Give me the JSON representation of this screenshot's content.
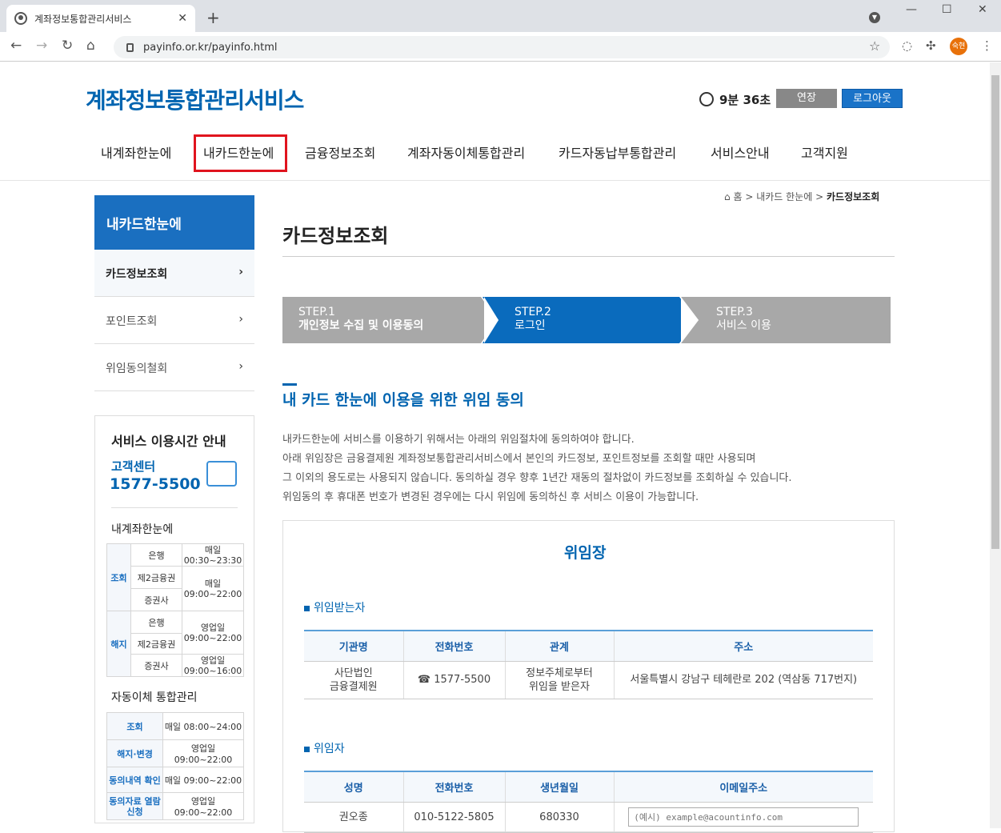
{
  "browser": {
    "tab_title": "계좌정보통합관리서비스",
    "tab_close": "✕",
    "new_tab": "+",
    "url": "payinfo.or.kr/payinfo.html",
    "profile_label": "숙현",
    "icons": [
      "back-icon",
      "forward-icon",
      "reload-icon",
      "home-icon",
      "lock-icon",
      "star-icon",
      "puzzle-icon",
      "menu-icon"
    ]
  },
  "header": {
    "logo": "계좌정보통합관리서비스",
    "timer": "9분 36초",
    "extend": "연장",
    "logout": "로그아웃"
  },
  "gnb": [
    "내계좌한눈에",
    "내카드한눈에",
    "금융정보조회",
    "계좌자동이체통합관리",
    "카드자동납부통합관리",
    "서비스안내",
    "고객지원"
  ],
  "lnb": {
    "title": "내카드한눈에",
    "items": [
      "카드정보조회",
      "포인트조회",
      "위임동의철회"
    ]
  },
  "service_hours": {
    "title": "서비스 이용시간 안내",
    "cc_label": "고객센터",
    "cc_number": "1577-5500",
    "sec1_title": "내계좌한눈에",
    "sec1": {
      "k1": "조회",
      "k2": "해지",
      "r1": "은행",
      "r2": "제2금융권",
      "r3": "증권사",
      "r4": "은행",
      "r5": "제2금융권",
      "r6": "증권사",
      "v1a": "매일",
      "v1b": "00:30~23:30",
      "v2a": "매일",
      "v2b": "09:00~22:00",
      "v3a": "영업일",
      "v3b": "09:00~22:00",
      "v4a": "영업일",
      "v4b": "09:00~16:00"
    },
    "sec2_title": "자동이체 통합관리",
    "sec2": [
      {
        "k": "조회",
        "v": "매일 08:00~24:00"
      },
      {
        "k": "해지·변경",
        "v": "영업일 09:00~22:00"
      },
      {
        "k": "동의내역 확인",
        "v": "매일 09:00~22:00"
      },
      {
        "k": "동의자료 열람신청",
        "v": "영업일 09:00~22:00"
      }
    ]
  },
  "breadcrumb": {
    "home": "홈",
    "mid": "내카드 한눈에",
    "current": "카드정보조회",
    "sep": ">"
  },
  "page_title": "카드정보조회",
  "steps": [
    {
      "num": "STEP.1",
      "label": "개인정보 수집 및 이용동의"
    },
    {
      "num": "STEP.2",
      "label": "로그인"
    },
    {
      "num": "STEP.3",
      "label": "서비스 이용"
    }
  ],
  "section_title": "내 카드 한눈에 이용을 위한 위임 동의",
  "description": [
    "내카드한눈에 서비스를 이용하기 위해서는 아래의 위임절차에 동의하여야 합니다.",
    "아래 위임장은 금융결제원 계좌정보통합관리서비스에서 본인의 카드정보, 포인트정보를 조회할 때만 사용되며",
    "그 이외의 용도로는 사용되지 않습니다. 동의하실 경우 향후 1년간 재동의 절차없이 카드정보를 조회하실 수 있습니다.",
    "위임동의 후 휴대폰 번호가 변경된 경우에는 다시 위임에 동의하신 후 서비스 이용이 가능합니다."
  ],
  "proxy": {
    "title": "위임장",
    "receiver_title": "위임받는자",
    "receiver_headers": [
      "기관명",
      "전화번호",
      "관계",
      "주소"
    ],
    "receiver_row": {
      "org1": "사단법인",
      "org2": "금융결제원",
      "phone": "☎ 1577-5500",
      "rel1": "정보주체로부터",
      "rel2": "위임을 받은자",
      "addr": "서울특별시 강남구 테헤란로 202 (역삼동 717번지)"
    },
    "giver_title": "위임자",
    "giver_headers": [
      "성명",
      "전화번호",
      "생년월일",
      "이메일주소"
    ],
    "giver_row": {
      "name": "권오종",
      "phone": "010-5122-5805",
      "birth": "680330",
      "email_placeholder": "(예시) example@acountinfo.com"
    }
  }
}
